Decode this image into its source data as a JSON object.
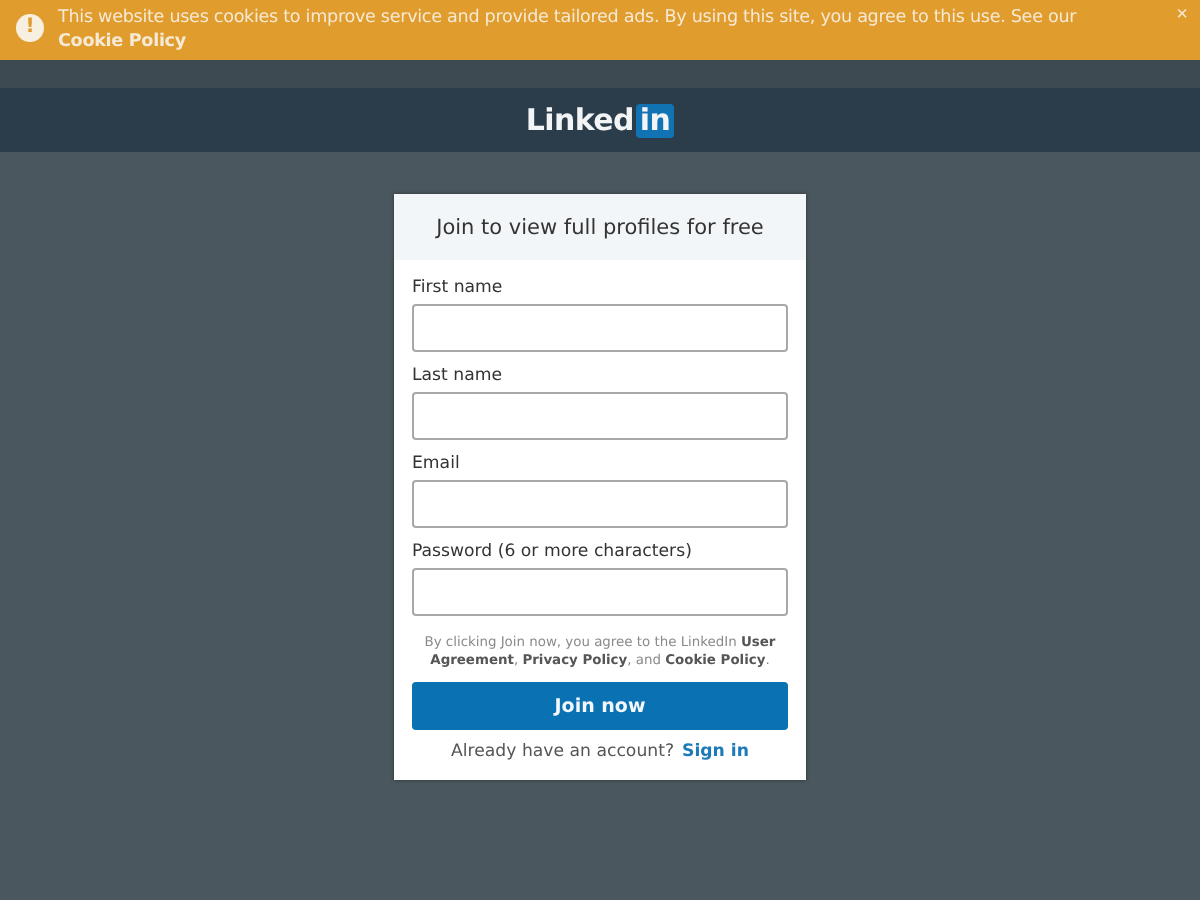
{
  "cookie_banner": {
    "icon": "!",
    "message": "This website uses cookies to improve service and provide tailored ads. By using this site, you agree to this use. See our",
    "link": "Cookie Policy",
    "close": "×"
  },
  "header": {
    "logo_text": "Linked",
    "logo_badge": "in"
  },
  "signup": {
    "title": "Join to view full profiles for free",
    "fields": [
      {
        "label": "First name"
      },
      {
        "label": "Last name"
      },
      {
        "label": "Email"
      },
      {
        "label": "Password (6 or more characters)"
      }
    ],
    "legal": "By clicking Join now, you agree to the LinkedIn **User Agreement**, **Privacy Policy**, and **Cookie Policy**.",
    "submit": "Join now",
    "signin_prompt": "Already have an account?",
    "signin_link": "Sign in"
  }
}
